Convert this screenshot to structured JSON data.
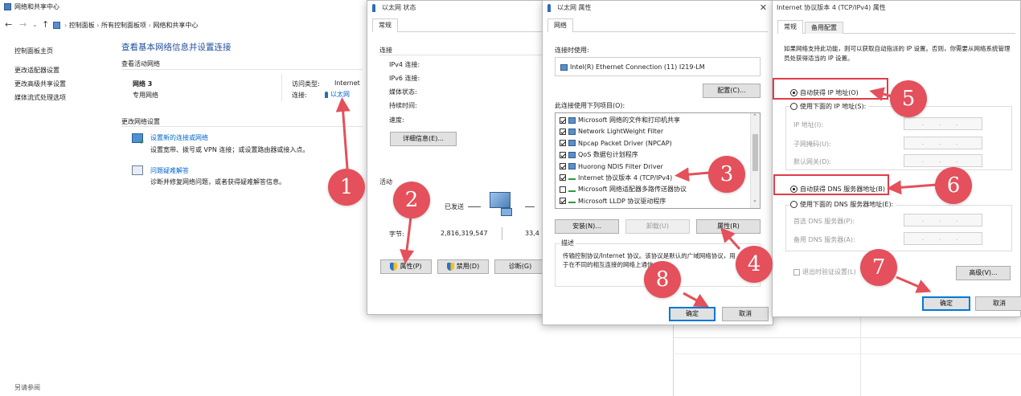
{
  "nsc": {
    "title": "网络和共享中心",
    "breadcrumb": [
      "控制面板",
      "所有控制面板项",
      "网络和共享中心"
    ],
    "sidebar": [
      "控制面板主页",
      "更改适配器设置",
      "更改高级共享设置",
      "媒体流式处理选项"
    ],
    "heading": "查看基本网络信息并设置连接",
    "active_networks_label": "查看活动网络",
    "network_name": "网络 3",
    "network_type": "专用网络",
    "access_type_label": "访问类型:",
    "access_type_value": "Internet",
    "connection_label": "连接:",
    "connection_value": "以太网",
    "change_settings_label": "更改网络设置",
    "new_connection_link": "设置新的连接或网络",
    "new_connection_desc": "设置宽带、拨号或 VPN 连接；或设置路由器或接入点。",
    "troubleshoot_link": "问题疑难解答",
    "troubleshoot_desc": "诊断并修复网络问题，或者获得疑难解答信息。",
    "see_also": "另请参阅"
  },
  "status": {
    "title": "以太网 状态",
    "tab": "常规",
    "connection_section": "连接",
    "fields": [
      "IPv4 连接:",
      "IPv6 连接:",
      "媒体状态:",
      "持续时间:",
      "速度:"
    ],
    "details_button": "详细信息(E)...",
    "activity_section": "活动",
    "sent_label": "已发送",
    "bytes_label": "字节:",
    "bytes_sent": "2,816,319,547",
    "bytes_received_partial": "33,4",
    "properties_button": "属性(P)",
    "disable_button": "禁用(D)",
    "diagnose_button": "诊断(G)"
  },
  "props": {
    "title": "以太网 属性",
    "tab": "网络",
    "connect_using_label": "连接时使用:",
    "adapter": "Intel(R) Ethernet Connection (11) I219-LM",
    "configure_button": "配置(C)...",
    "items_label": "此连接使用下列项目(O):",
    "items": [
      {
        "label": "Microsoft 网络的文件和打印机共享",
        "checked": true
      },
      {
        "label": "Network LightWeight Filter",
        "checked": true
      },
      {
        "label": "Npcap Packet Driver (NPCAP)",
        "checked": true
      },
      {
        "label": "QoS 数据包计划程序",
        "checked": true
      },
      {
        "label": "Huorong NDIS Filter Driver",
        "checked": true
      },
      {
        "label": "Internet 协议版本 4 (TCP/IPv4)",
        "checked": true
      },
      {
        "label": "Microsoft 网络适配器多路传送器协议",
        "checked": false
      },
      {
        "label": "Microsoft LLDP 协议驱动程序",
        "checked": true
      }
    ],
    "install_button": "安装(N)...",
    "uninstall_button": "卸载(U)",
    "properties_button": "属性(R)",
    "description_label": "描述",
    "description_text": "传输控制协议/Internet 协议。该协议是默认的广域网络协议，用于在不同的相互连接的网络上通信。",
    "ok_button": "确定",
    "cancel_button": "取消"
  },
  "ipv4": {
    "title": "Internet 协议版本 4 (TCP/IPv4) 属性",
    "tab_general": "常规",
    "tab_alternate": "备用配置",
    "intro": "如果网络支持此功能，则可以获取自动指派的 IP 设置。否则，你需要从网络系统管理员处获得适当的 IP 设置。",
    "auto_ip": "自动获得 IP 地址(O)",
    "manual_ip": "使用下面的 IP 地址(S):",
    "ip_address": "IP 地址(I):",
    "subnet_mask": "子网掩码(U):",
    "gateway": "默认网关(D):",
    "auto_dns": "自动获得 DNS 服务器地址(B)",
    "manual_dns": "使用下面的 DNS 服务器地址(E):",
    "preferred_dns": "首选 DNS 服务器(P):",
    "alternate_dns": "备用 DNS 服务器(A):",
    "validate_on_exit": "退出时验证设置(L)",
    "advanced_button": "高级(V)...",
    "ok_button": "确定",
    "cancel_button": "取消",
    "ip_placeholder": ". . ."
  },
  "markers": [
    "1",
    "2",
    "3",
    "4",
    "5",
    "6",
    "7",
    "8"
  ],
  "colors": {
    "marker": "#e4505b",
    "link": "#0066cc",
    "accent": "#0078d7"
  }
}
